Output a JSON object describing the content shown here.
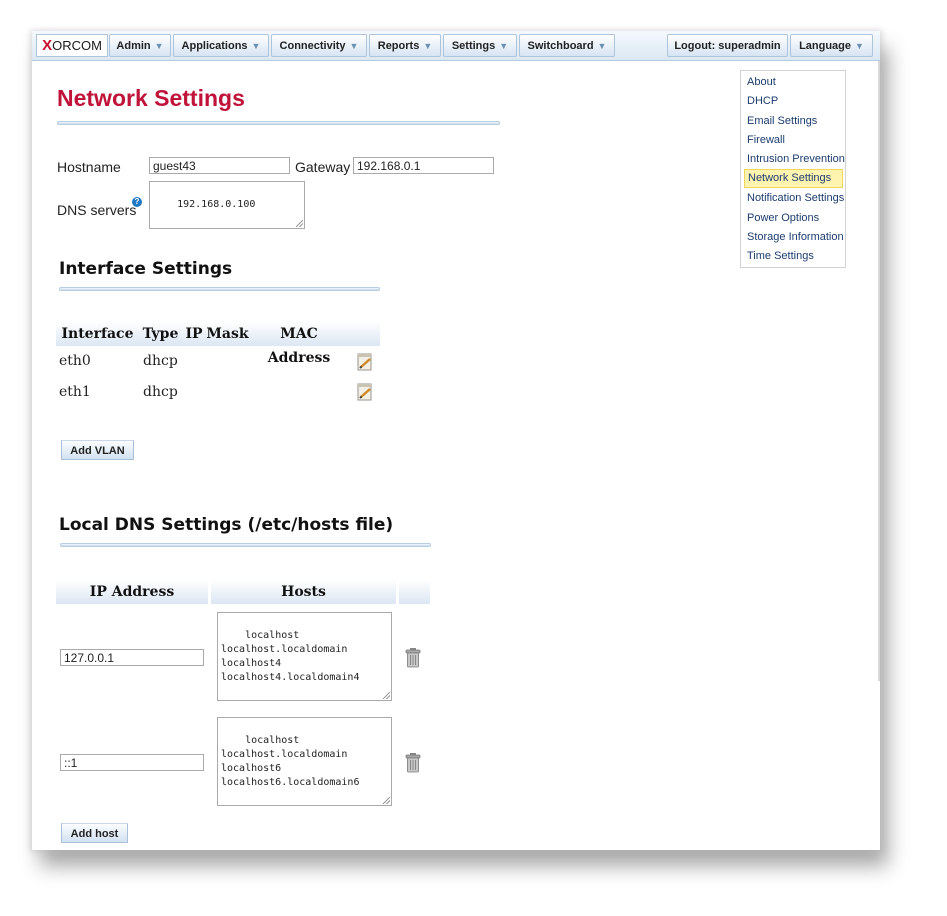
{
  "brand": {
    "logo_x": "X",
    "logo_rest": "ORCOM"
  },
  "nav": {
    "items": [
      {
        "label": "Admin"
      },
      {
        "label": "Applications"
      },
      {
        "label": "Connectivity"
      },
      {
        "label": "Reports"
      },
      {
        "label": "Settings"
      },
      {
        "label": "Switchboard"
      }
    ],
    "logout": "Logout: superadmin",
    "language": "Language"
  },
  "page": {
    "title": "Network Settings"
  },
  "general": {
    "hostname_label": "Hostname",
    "hostname_value": "guest43",
    "gateway_label": "Gateway",
    "gateway_value": "192.168.0.1",
    "dns_label": "DNS servers",
    "dns_value": "192.168.0.100",
    "help_icon": "?"
  },
  "interfaces": {
    "title": "Interface Settings",
    "columns": [
      "Interface",
      "Type",
      "IP",
      "Mask",
      "MAC Address"
    ],
    "rows": [
      {
        "interface": "eth0",
        "type": "dhcp",
        "ip": "",
        "mask": "",
        "mac": ""
      },
      {
        "interface": "eth1",
        "type": "dhcp",
        "ip": "",
        "mask": "",
        "mac": ""
      }
    ],
    "add_vlan": "Add VLAN"
  },
  "local_dns": {
    "title": "Local DNS Settings (/etc/hosts file)",
    "columns": [
      "IP Address",
      "Hosts"
    ],
    "rows": [
      {
        "ip": "127.0.0.1",
        "hosts": "localhost\nlocalhost.localdomain\nlocalhost4\nlocalhost4.localdomain4"
      },
      {
        "ip": "::1",
        "hosts": "localhost\nlocalhost.localdomain\nlocalhost6\nlocalhost6.localdomain6"
      }
    ],
    "add_host": "Add host"
  },
  "sidemenu": {
    "items": [
      {
        "label": "About"
      },
      {
        "label": "DHCP"
      },
      {
        "label": "Email Settings"
      },
      {
        "label": "Firewall"
      },
      {
        "label": "Intrusion Prevention"
      },
      {
        "label": "Network Settings",
        "active": true
      },
      {
        "label": "Notification Settings"
      },
      {
        "label": "Power Options"
      },
      {
        "label": "Storage Information"
      },
      {
        "label": "Time Settings"
      }
    ]
  }
}
